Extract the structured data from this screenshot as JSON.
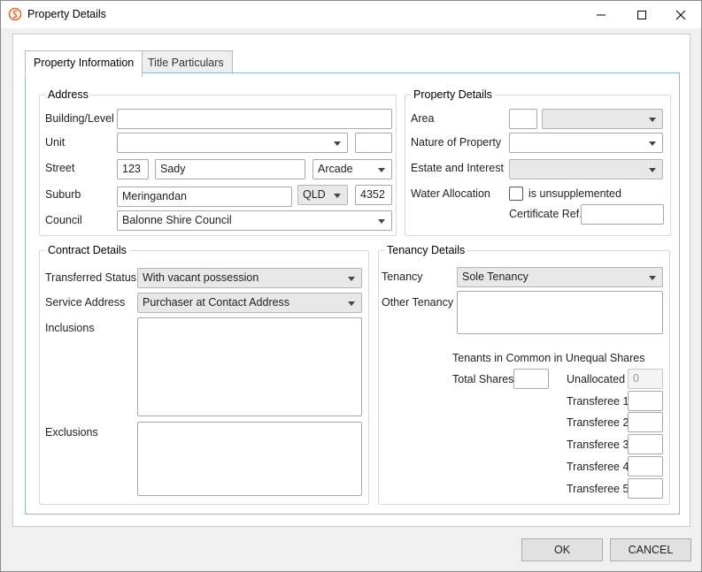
{
  "window": {
    "title": "Property Details"
  },
  "tabs": [
    "Property Information",
    "Title Particulars"
  ],
  "address": {
    "title": "Address",
    "labels": {
      "building": "Building/Level",
      "unit": "Unit",
      "street": "Street",
      "suburb": "Suburb",
      "council": "Council"
    },
    "building_value": "",
    "unit_value": "",
    "unit_extra": "",
    "street_number": "123",
    "street_name": "Sady",
    "street_type": "Arcade",
    "suburb": "Meringandan",
    "state": "QLD",
    "postcode": "4352",
    "council": "Balonne Shire Council"
  },
  "property_details": {
    "title": "Property Details",
    "labels": {
      "area": "Area",
      "nature": "Nature of Property",
      "estate": "Estate and Interest",
      "water": "Water Allocation",
      "certificate": "Certificate Ref."
    },
    "area_value": "",
    "area_unit": "",
    "nature_value": "",
    "estate_value": "",
    "unsupplemented_label": "is unsupplemented",
    "unsupplemented_checked": false,
    "certificate_value": ""
  },
  "contract": {
    "title": "Contract Details",
    "labels": {
      "transferred": "Transferred Status",
      "service": "Service Address",
      "inclusions": "Inclusions",
      "exclusions": "Exclusions"
    },
    "transferred_value": "With vacant possession",
    "service_value": "Purchaser at Contact Address"
  },
  "tenancy": {
    "title": "Tenancy Details",
    "labels": {
      "tenancy": "Tenancy",
      "other": "Other Tenancy",
      "common": "Tenants in Common in Unequal Shares",
      "total": "Total Shares",
      "unallocated": "Unallocated"
    },
    "tenancy_value": "Sole Tenancy",
    "unallocated_value": "0",
    "transferees": [
      "Transferee 1",
      "Transferee 2",
      "Transferee 3",
      "Transferee 4",
      "Transferee 5"
    ]
  },
  "buttons": {
    "ok": "OK",
    "cancel": "CANCEL"
  },
  "colors": {
    "accent_border": "#8fb6d8",
    "logo": "#e8692c"
  }
}
